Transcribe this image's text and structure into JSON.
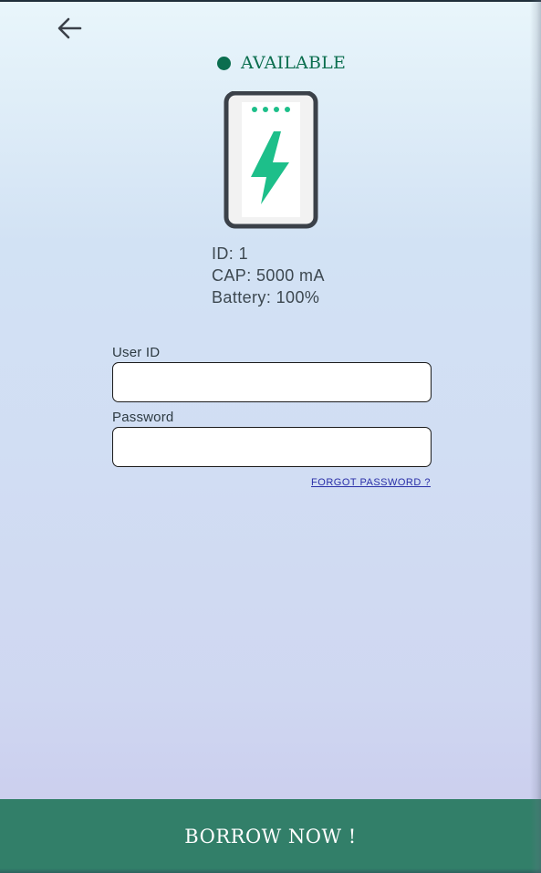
{
  "header": {
    "back_icon": "arrow-left-icon"
  },
  "status": {
    "label": "AVAILABLE",
    "color": "#0b6e4f"
  },
  "device": {
    "icon": "power-bank-icon",
    "accent_color": "#1dbf8a",
    "info": {
      "id": "ID: 1",
      "capacity": "CAP: 5000 mA",
      "battery": "Battery: 100%"
    }
  },
  "form": {
    "user_id_label": "User ID",
    "user_id_value": "",
    "password_label": "Password",
    "password_value": "",
    "forgot_password": "FORGOT PASSWORD ?"
  },
  "action": {
    "borrow_label": "BORROW NOW !",
    "color": "#327f69"
  }
}
